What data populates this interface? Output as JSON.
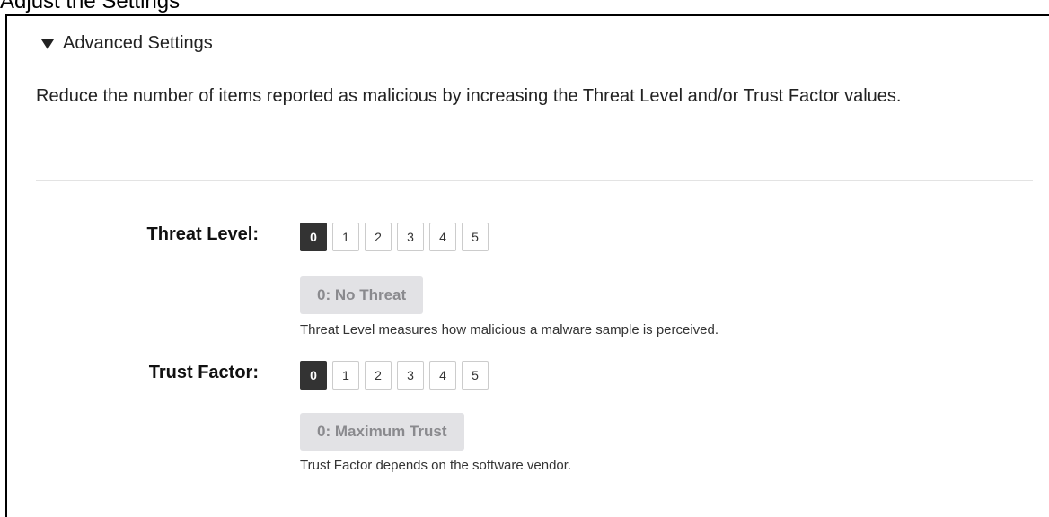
{
  "header_fragment": "Adjust the Settings",
  "advanced_settings": {
    "title": "Advanced Settings",
    "description": "Reduce the number of items reported as malicious by increasing the Threat Level and/or Trust Factor values."
  },
  "threat_level": {
    "label": "Threat Level:",
    "options": [
      "0",
      "1",
      "2",
      "3",
      "4",
      "5"
    ],
    "selected": "0",
    "value_text": "0: No Threat",
    "help": "Threat Level measures how malicious a malware sample is perceived."
  },
  "trust_factor": {
    "label": "Trust Factor:",
    "options": [
      "0",
      "1",
      "2",
      "3",
      "4",
      "5"
    ],
    "selected": "0",
    "value_text": "0: Maximum Trust",
    "help": "Trust Factor depends on the software vendor."
  },
  "colors": {
    "selected_button": "#333333",
    "badge_background": "#e2e2e5",
    "badge_text": "#8a8a8e"
  },
  "icons": {
    "section_toggle": "caret-down-icon"
  }
}
